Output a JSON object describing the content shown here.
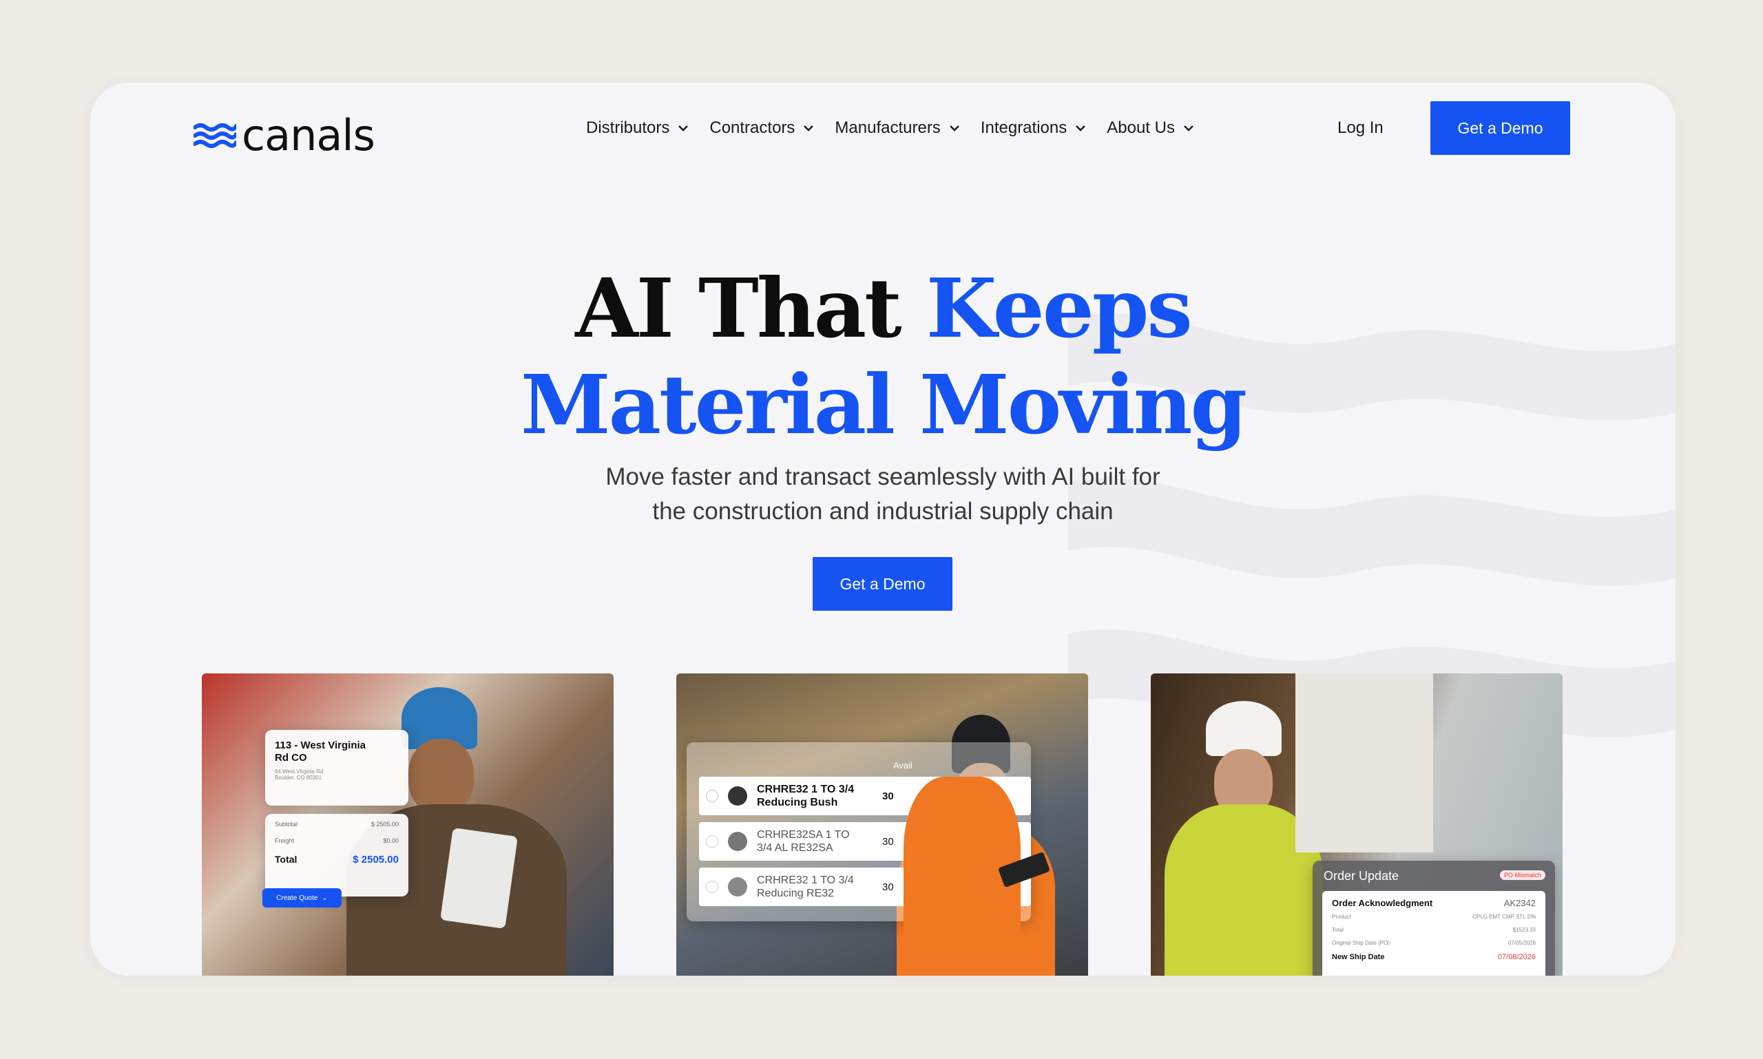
{
  "brand": {
    "name": "canals",
    "logo_icon": "waves-icon",
    "accent": "#1553f3"
  },
  "nav": {
    "items": [
      {
        "label": "Distributors"
      },
      {
        "label": "Contractors"
      },
      {
        "label": "Manufacturers"
      },
      {
        "label": "Integrations"
      },
      {
        "label": "About Us"
      }
    ],
    "login": "Log In",
    "cta": "Get a Demo"
  },
  "hero": {
    "headline_dark": "AI That ",
    "headline_blue_1": "Keeps",
    "headline_blue_2": "Material Moving",
    "subtitle_line1": "Move faster and transact seamlessly with AI built for",
    "subtitle_line2": "the construction and industrial supply chain",
    "cta": "Get a Demo"
  },
  "cards": {
    "quote": {
      "address_title": "113 - West Virginia Rd CO",
      "address_line1": "64 West Virginia Rd",
      "address_line2": "Boulder, CO 80301",
      "subtotal_label": "Subtotal",
      "subtotal_value": "$ 2505.00",
      "freight_label": "Freight",
      "freight_value": "$0.00",
      "total_label": "Total",
      "total_value": "$ 2505.00",
      "button": "Create Quote"
    },
    "availability": {
      "header": "Avail",
      "items": [
        {
          "name": "CRHRE32 1 TO 3/4 Reducing Bush",
          "qty": "30"
        },
        {
          "name": "CRHRE32SA 1 TO 3/4 AL RE32SA",
          "qty": "30"
        },
        {
          "name": "CRHRE32 1 TO 3/4 Reducing RE32",
          "qty": "30"
        }
      ]
    },
    "order": {
      "title": "Order Update",
      "badge": "PO Mismatch",
      "ack_label": "Order Acknowledgment",
      "ack_id": "AK2342",
      "product_label": "Product",
      "product_value": "CPLG EMT CMP STL 2IN",
      "total_label": "Total",
      "total_value": "$1523.33",
      "ship_label": "Original Ship Date (PO)",
      "ship_value": "07/05/2026",
      "new_ship_label": "New Ship Date",
      "new_ship_value": "07/08/2026"
    }
  }
}
